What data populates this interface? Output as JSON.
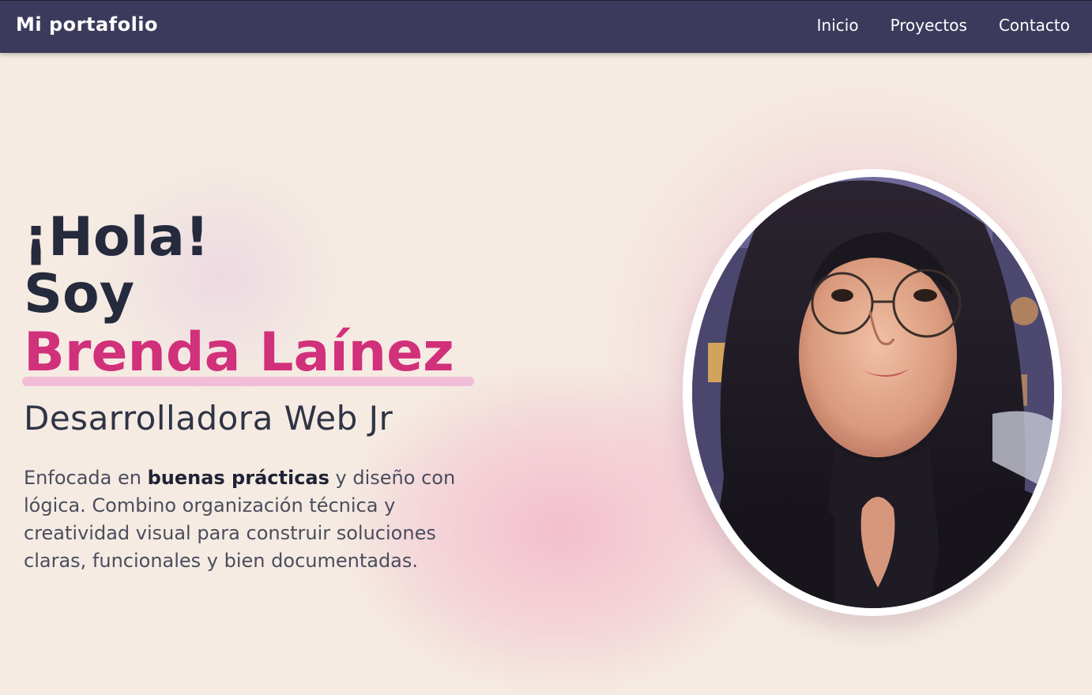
{
  "nav": {
    "brand": "Mi portafolio",
    "links": [
      "Inicio",
      "Proyectos",
      "Contacto"
    ]
  },
  "hero": {
    "greeting_line1": "¡Hola!",
    "greeting_line2": "Soy",
    "name": "Brenda Laínez",
    "role": "Desarrolladora Web Jr",
    "desc_part1": "Enfocada en ",
    "desc_bold": "buenas prácticas",
    "desc_part2": " y diseño con lógica. Combino organización técnica y creatividad visual para construir soluciones claras, funcionales y bien documentadas."
  },
  "colors": {
    "navbar": "#3c3a5c",
    "background": "#f5ebe2",
    "accent": "#d1307a",
    "text_dark": "#252a3d"
  },
  "icons": {
    "portrait": "avatar-illustration"
  }
}
